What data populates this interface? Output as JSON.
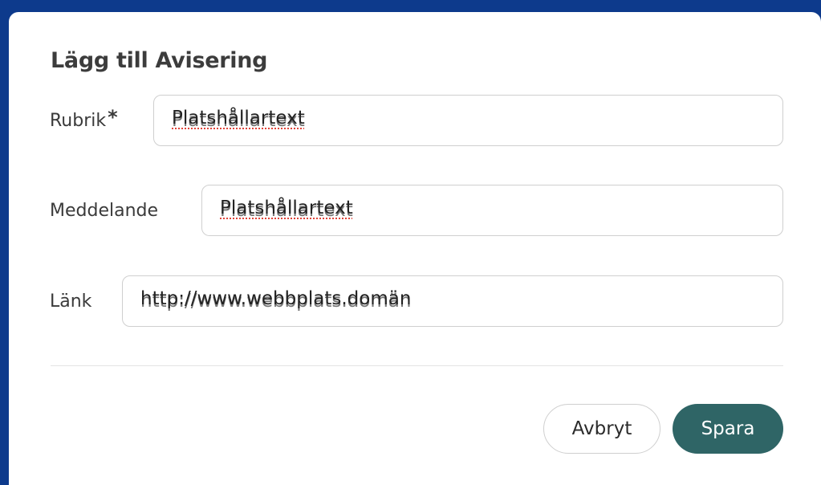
{
  "dialog": {
    "title": "Lägg till Avisering"
  },
  "fields": {
    "rubrik": {
      "label": "Rubrik",
      "required_marker": "*",
      "placeholder": "Platshållartext"
    },
    "meddelande": {
      "label": "Meddelande",
      "placeholder": "Platshållartext"
    },
    "lank": {
      "label": "Länk",
      "placeholder": "http://www.webbplats.domän"
    }
  },
  "actions": {
    "cancel_label": "Avbryt",
    "save_label": "Spara"
  },
  "colors": {
    "backdrop": "#0d3a8c",
    "primary": "#2f6566",
    "border": "#cfcfcf"
  }
}
